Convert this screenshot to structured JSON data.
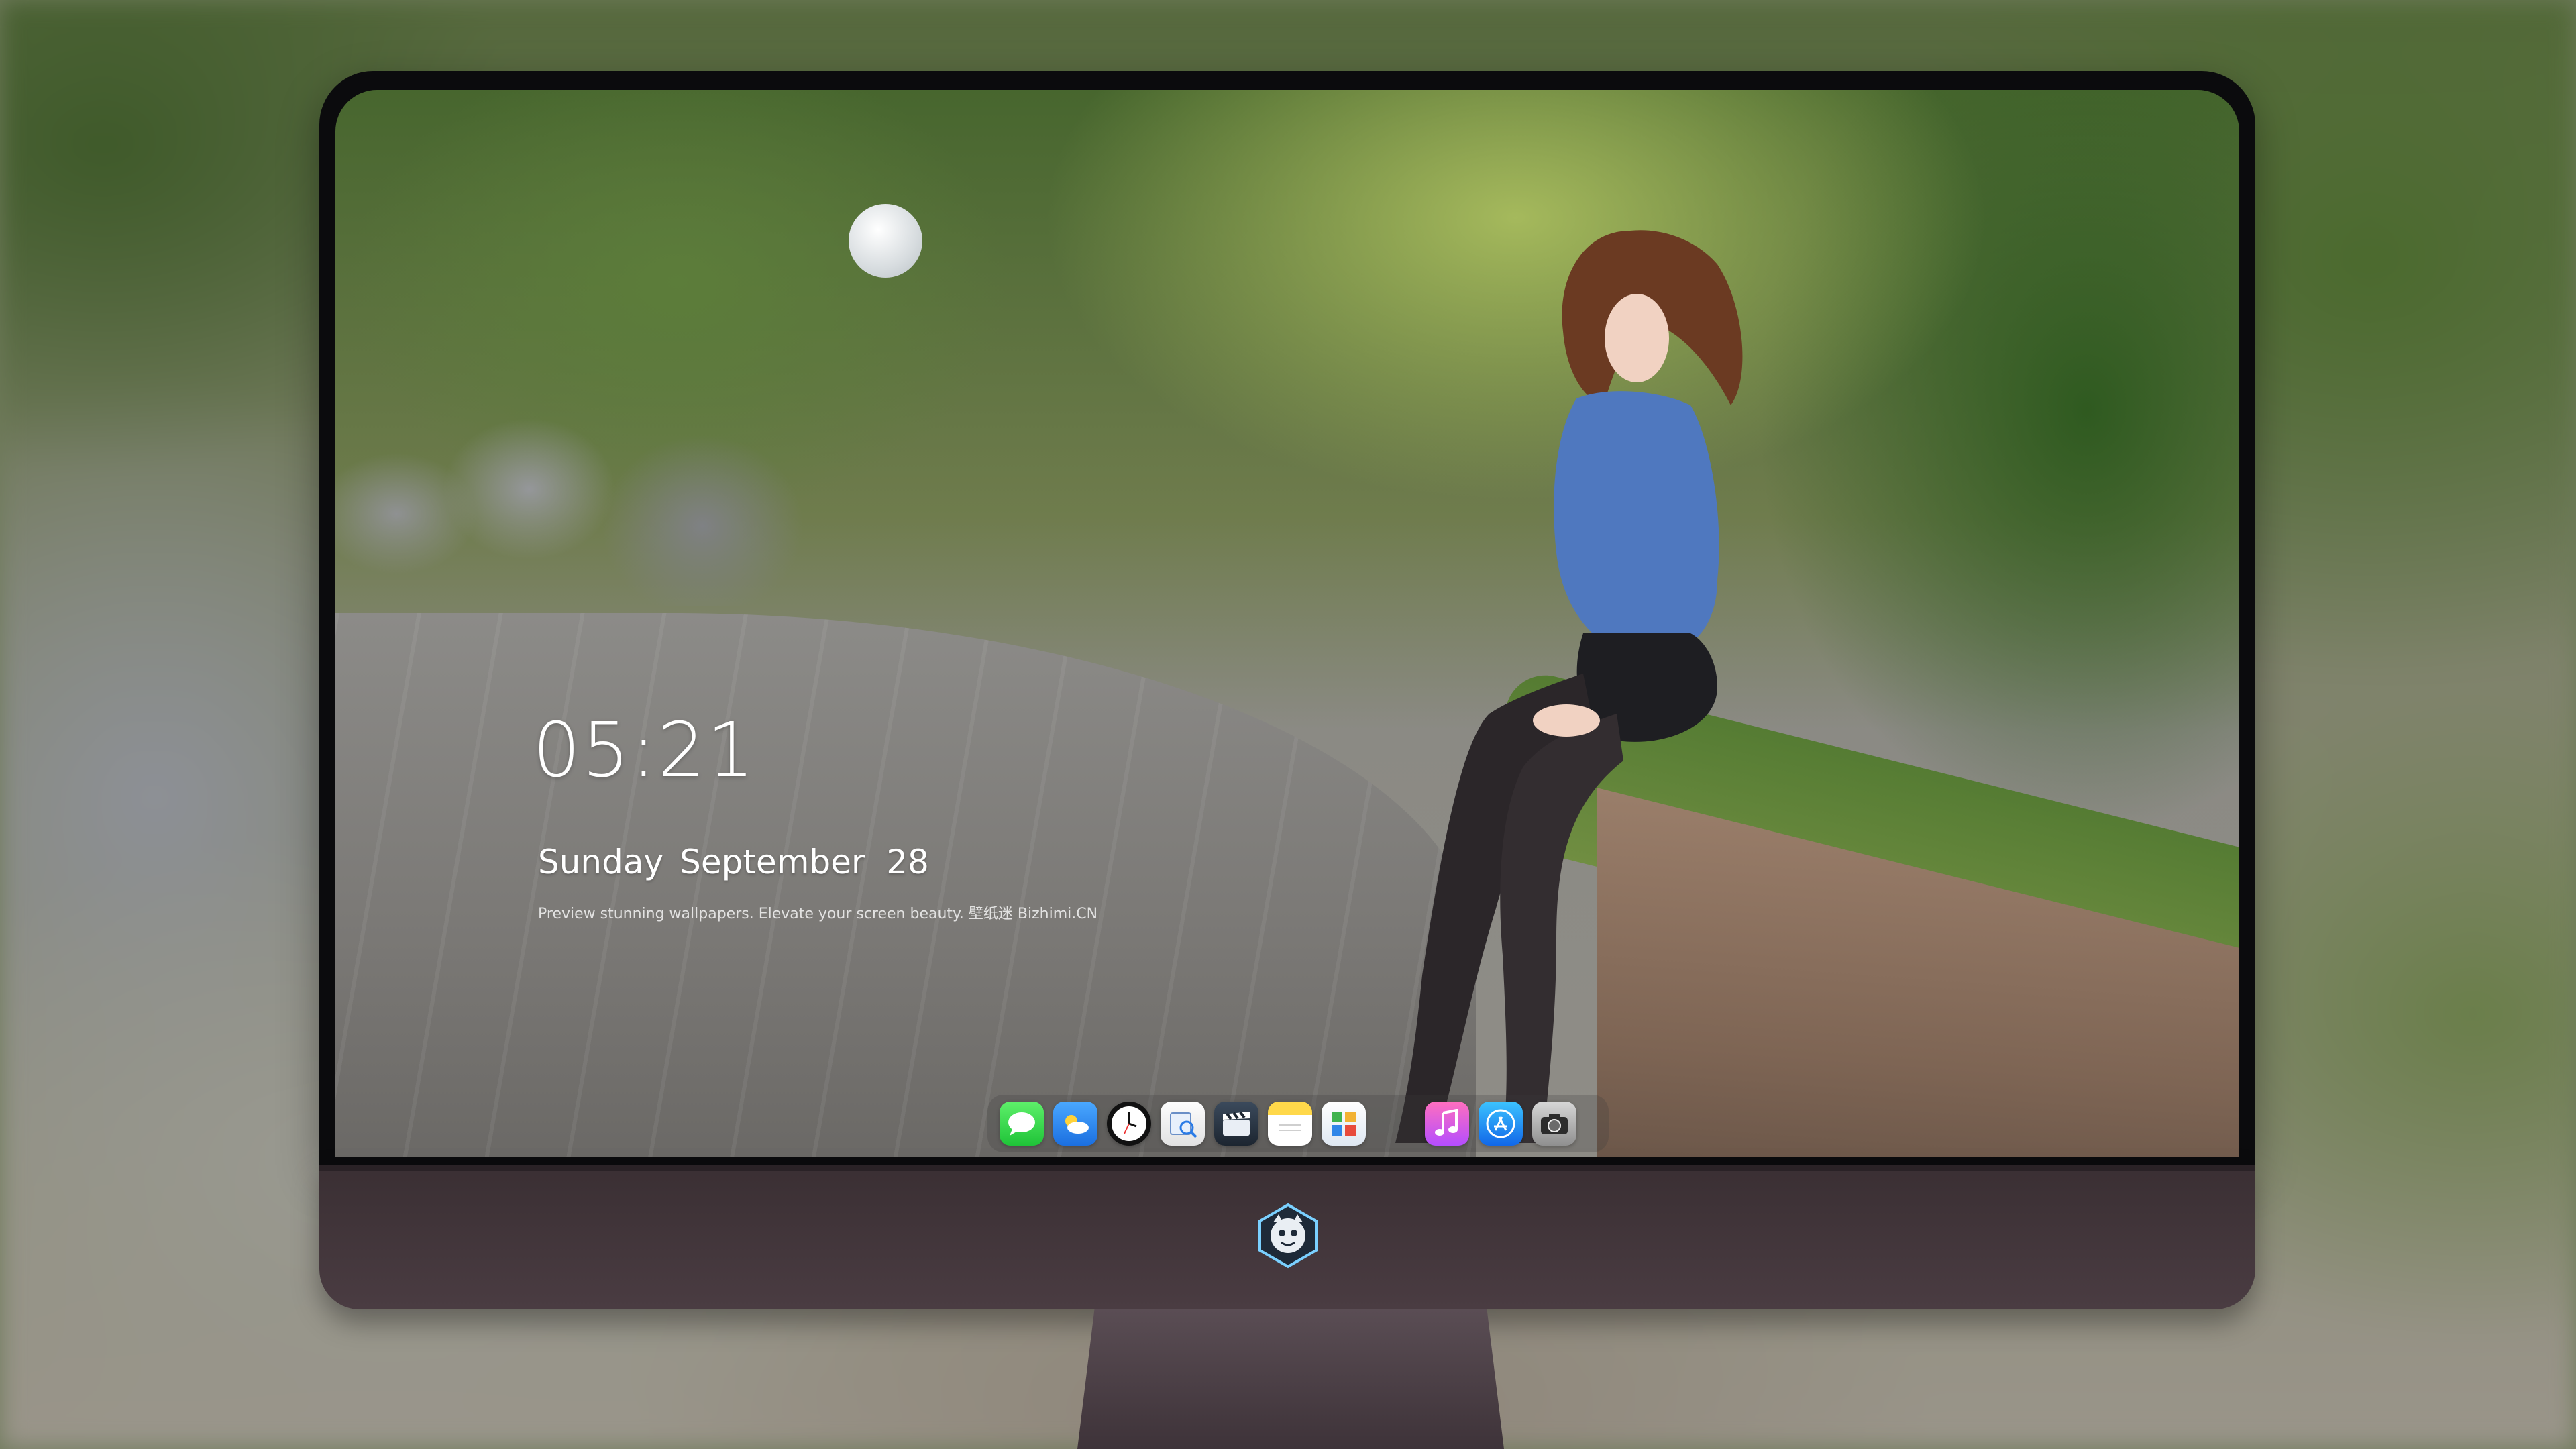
{
  "lockscreen": {
    "time": "05:21",
    "day": "Sunday",
    "month_day": "September  28",
    "tagline": "Preview stunning wallpapers. Elevate your screen beauty. 壁纸迷 Bizhimi.CN"
  },
  "dock": {
    "apps": [
      {
        "name": "Messages",
        "icon": "messages-icon"
      },
      {
        "name": "Weather",
        "icon": "weather-icon"
      },
      {
        "name": "Clock",
        "icon": "clock-icon"
      },
      {
        "name": "Preview",
        "icon": "preview-icon"
      },
      {
        "name": "Claquette",
        "icon": "clapperboard-icon"
      },
      {
        "name": "Notes",
        "icon": "notes-icon"
      },
      {
        "name": "Photo App",
        "icon": "photo-app-icon"
      },
      {
        "name": "Music",
        "icon": "music-icon"
      },
      {
        "name": "App Store",
        "icon": "app-store-icon"
      },
      {
        "name": "Camera",
        "icon": "camera-icon"
      }
    ]
  },
  "colors": {
    "bezel": "#0b0b0d",
    "chin": "#3a2f33",
    "text": "#ffffff"
  }
}
